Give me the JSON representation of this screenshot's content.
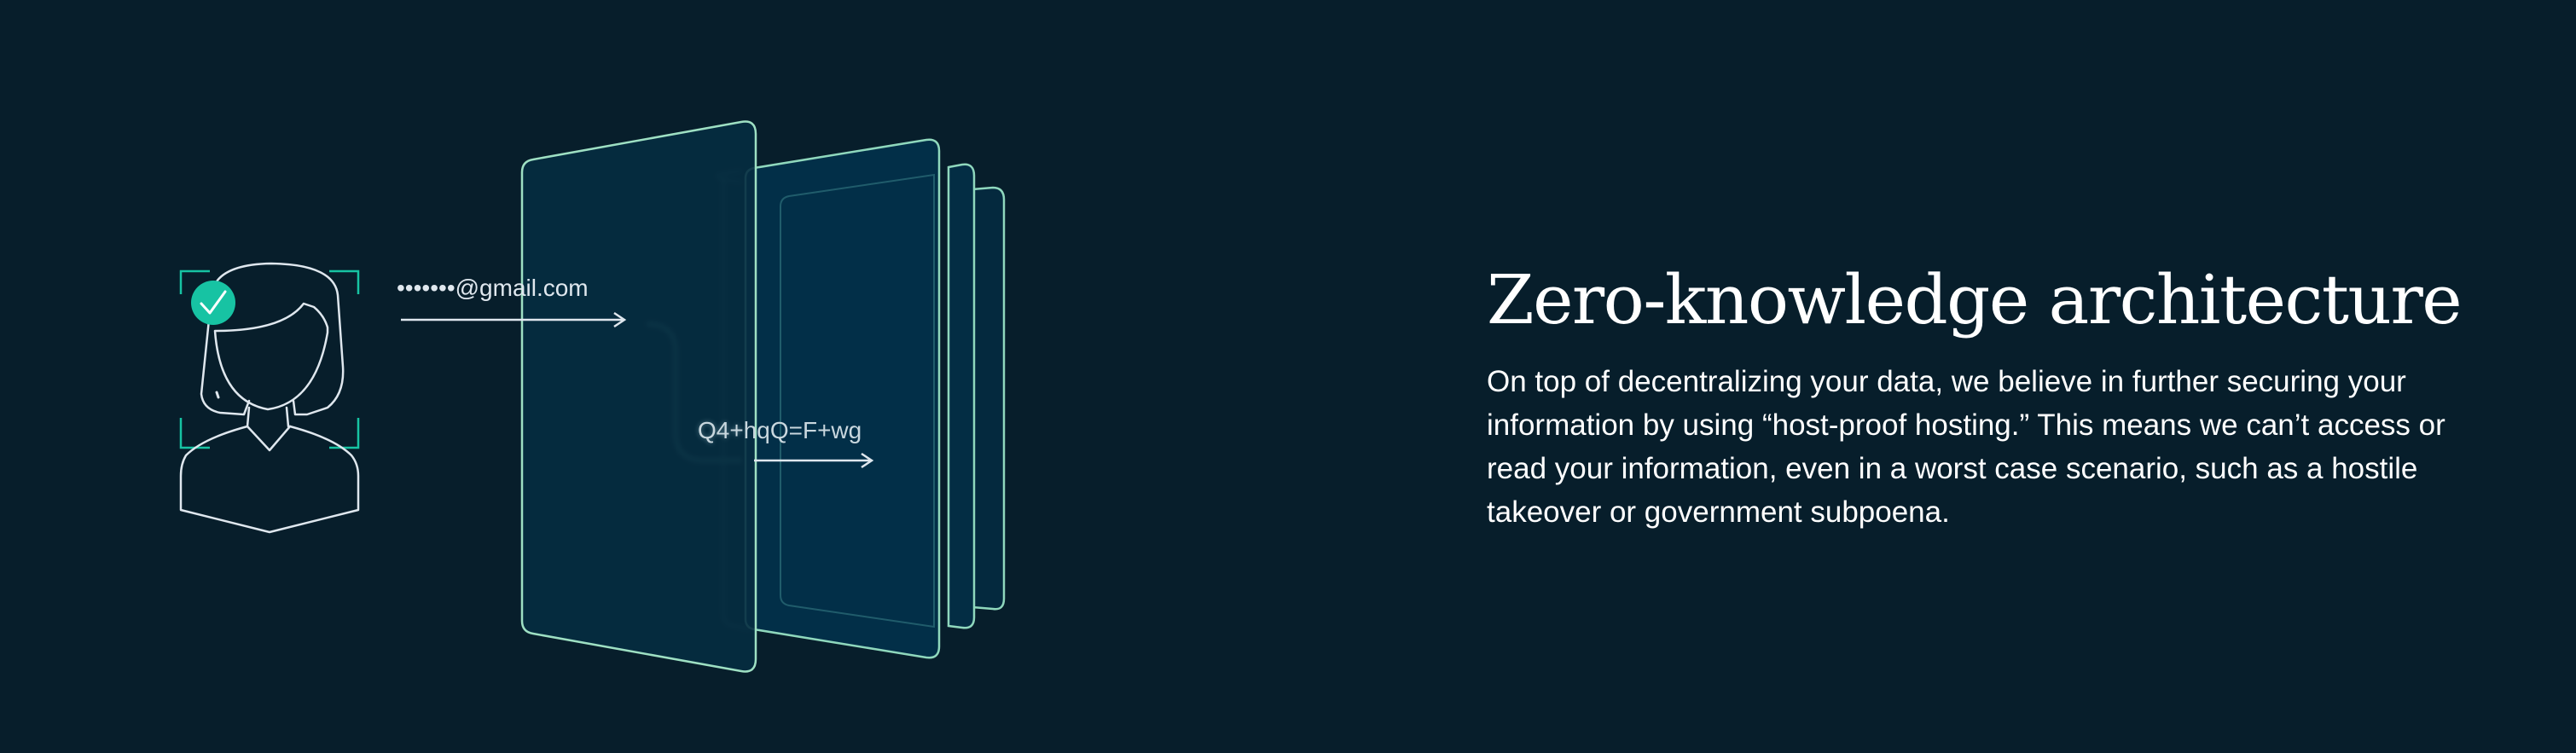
{
  "illustration": {
    "email_text": "•••••••@gmail.com",
    "cipher_text": "Q4+hqQ=F+wg",
    "user_icon": "user-avatar-icon",
    "check_icon": "checkmark-icon",
    "colors": {
      "accent": "#17c3a3",
      "line": "#9ee0c3",
      "panel": "#052c40",
      "face_line": "#dfe7ee"
    }
  },
  "feature": {
    "title": "Zero-knowledge architecture",
    "description": "On top of decentralizing your data, we believe in further securing your information by using “host-proof hosting.” This means we can’t access or read your information, even in a worst case scenario, such as a hostile takeover or government subpoena."
  },
  "colors": {
    "background": "#071e2b",
    "text": "#ffffff"
  }
}
